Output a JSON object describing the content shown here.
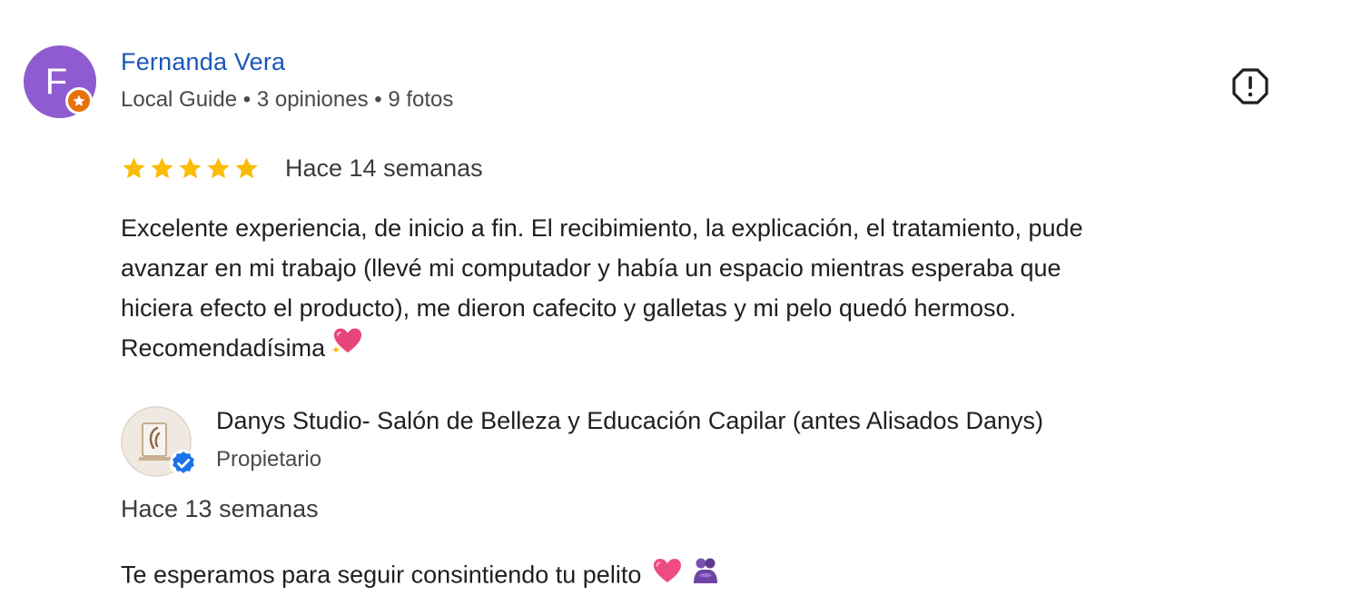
{
  "review": {
    "reviewer": {
      "name": "Fernanda Vera",
      "avatar_letter": "F",
      "avatar_color": "#8e5cd0",
      "badge_color": "#e8710a",
      "badge_icon": "local-guide-star-icon",
      "meta": "Local Guide • 3 opiniones • 9 fotos"
    },
    "report_icon": "report-flag-icon",
    "rating": {
      "stars": 5,
      "max": 5,
      "star_color": "#fbbc04"
    },
    "date": "Hace 14 semanas",
    "text_lines": [
      "Excelente experiencia, de inicio a fin. El recibimiento, la explicación, el tratamiento, pude",
      "avanzar en mi trabajo (llevé mi computador y había un espacio mientras esperaba que",
      "hiciera efecto el producto), me dieron cafecito y galletas y mi pelo quedó hermoso.",
      "Recomendadísima"
    ],
    "text_emoji": "sparkling-heart-icon"
  },
  "owner_response": {
    "name": "Danys Studio- Salón de Belleza y Educación Capilar (antes Alisados Danys)",
    "role": "Propietario",
    "verified_icon": "verified-check-icon",
    "date": "Hace 13 semanas",
    "reply": "Te esperamos para seguir consintiendo tu pelito",
    "reply_emojis": [
      "heart-icon",
      "people-hugging-icon"
    ]
  }
}
